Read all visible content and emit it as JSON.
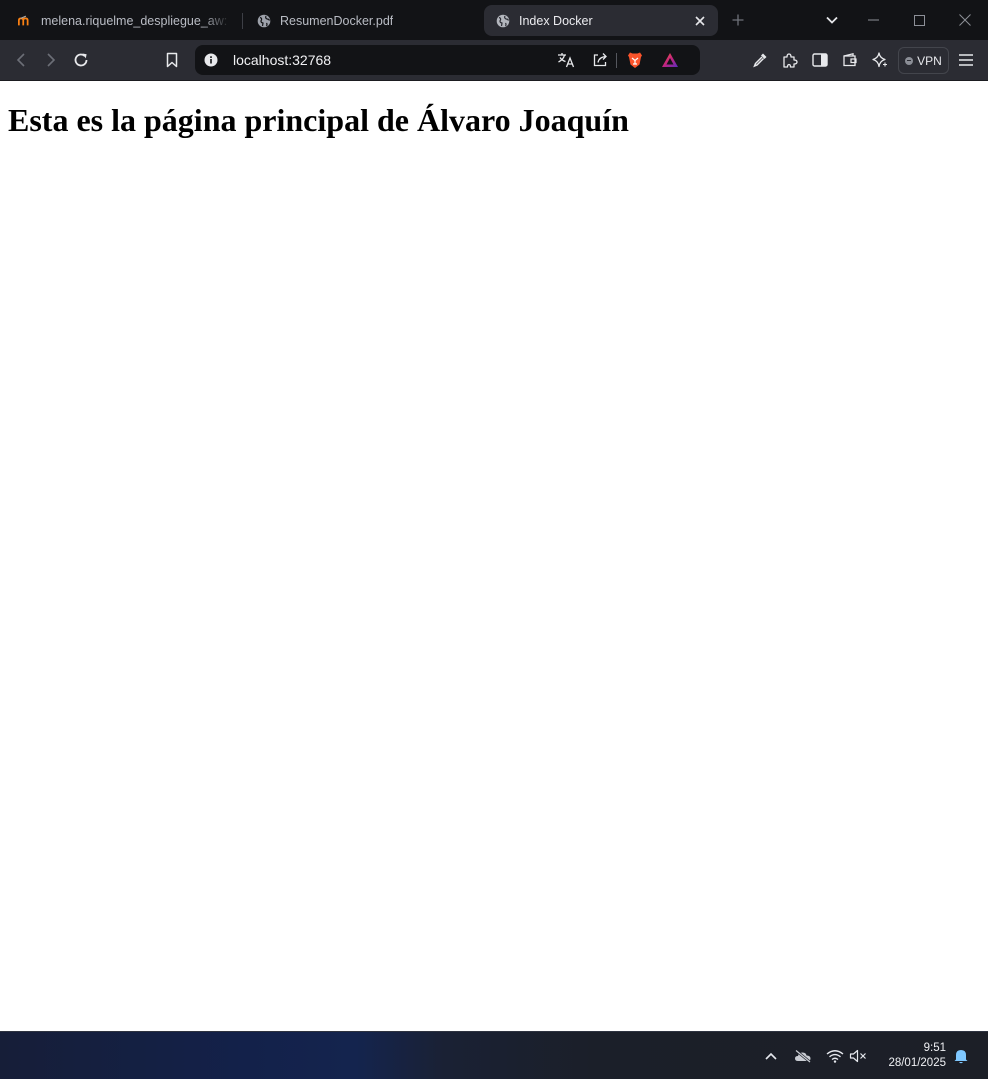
{
  "browser": {
    "tabs": [
      {
        "title": "melena.riquelme_despliegue_aw: Pr",
        "favicon": "moodle-icon",
        "active": false
      },
      {
        "title": "ResumenDocker.pdf",
        "favicon": "globe-icon",
        "active": false
      },
      {
        "title": "Index Docker",
        "favicon": "globe-icon",
        "active": true
      }
    ],
    "address": "localhost:32768",
    "vpn_label": "VPN"
  },
  "page": {
    "heading": "Esta es la página principal de Álvaro Joaquín"
  },
  "taskbar": {
    "time": "9:51",
    "date": "28/01/2025"
  },
  "colors": {
    "tabstrip_bg": "#121316",
    "toolbar_bg": "#2b2c33",
    "active_tab_bg": "#2b2c33",
    "brave_orange": "#fb542b",
    "notification_blue": "#7fc8ff"
  }
}
